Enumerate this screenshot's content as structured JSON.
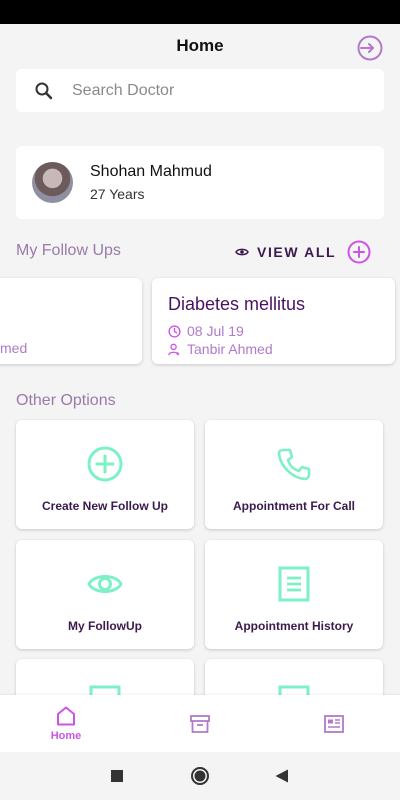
{
  "header": {
    "title": "Home"
  },
  "search": {
    "placeholder": "Search Doctor"
  },
  "profile": {
    "name": "Shohan Mahmud",
    "age": "27 Years"
  },
  "followups": {
    "section_title": "My Follow Ups",
    "view_all_label": "VIEW ALL",
    "cards": [
      {
        "title": "",
        "date": "",
        "doctor": "med"
      },
      {
        "title": "Diabetes mellitus",
        "date": "08 Jul 19",
        "doctor": "Tanbir Ahmed"
      }
    ]
  },
  "other_options": {
    "section_title": "Other Options",
    "items": [
      {
        "label": "Create New Follow Up",
        "icon": "plus-circle-icon"
      },
      {
        "label": "Appointment For Call",
        "icon": "phone-icon"
      },
      {
        "label": "My FollowUp",
        "icon": "eye-icon"
      },
      {
        "label": "Appointment History",
        "icon": "document-icon"
      },
      {
        "label": "",
        "icon": "document-icon"
      },
      {
        "label": "",
        "icon": "document-icon"
      }
    ]
  },
  "bottom_nav": {
    "items": [
      {
        "label": "Home",
        "icon": "home-icon",
        "active": true
      },
      {
        "label": "",
        "icon": "archive-icon",
        "active": false
      },
      {
        "label": "",
        "icon": "news-icon",
        "active": false
      }
    ]
  },
  "colors": {
    "accent": "#cc55e6",
    "mint": "#7df0c6",
    "dark_purple": "#3b1a4d"
  }
}
